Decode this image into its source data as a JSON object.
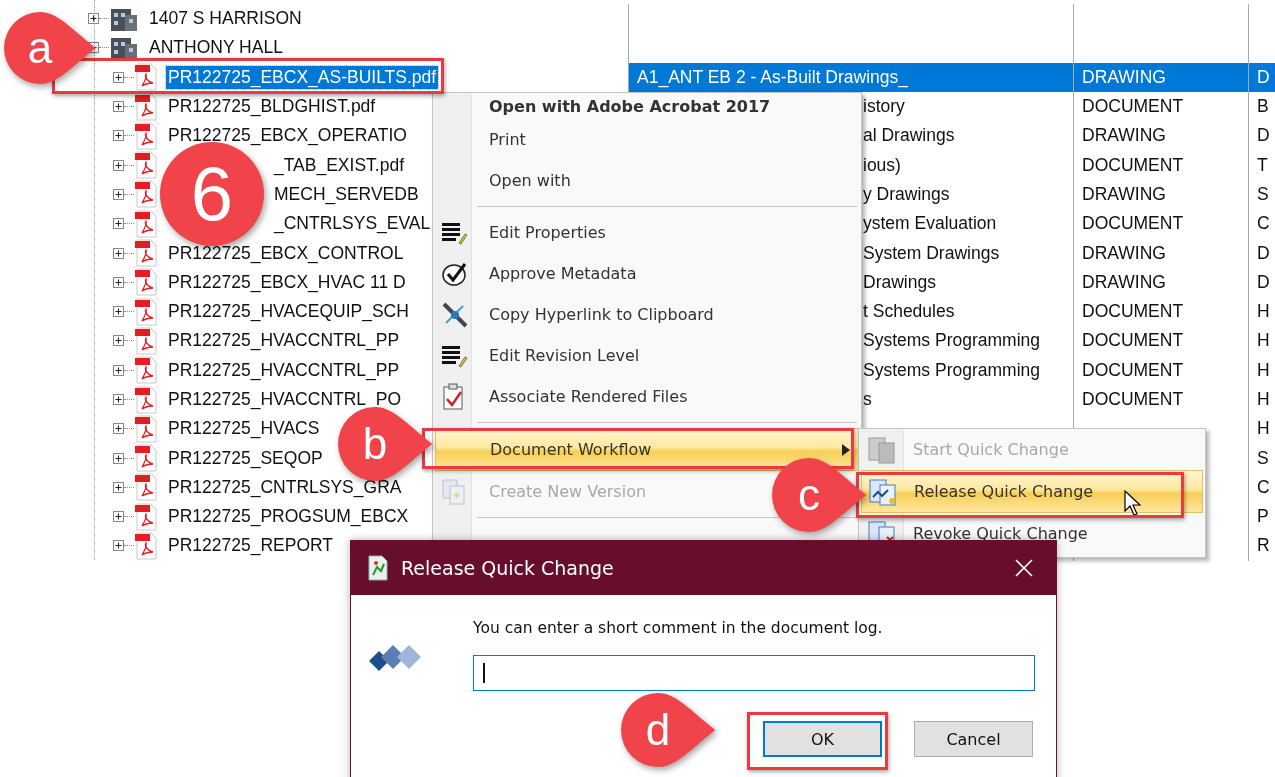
{
  "tree": {
    "rows": [
      {
        "kind": "building",
        "name": "1407 S HARRISON",
        "expanded": false,
        "selected": false,
        "under_callout": false
      },
      {
        "kind": "building",
        "name": "ANTHONY HALL",
        "expanded": true,
        "selected": false,
        "under_callout": false
      },
      {
        "kind": "pdf",
        "name": "PR122725_EBCX_AS-BUILTS.pdf",
        "column_2": "A1_ANT EB 2 - As-Built Drawings_",
        "column_3": "DRAWING",
        "column_4": "D",
        "expanded": false,
        "selected": true,
        "under_callout": false
      },
      {
        "kind": "pdf",
        "name": "PR122725_BLDGHIST.pdf",
        "column_2": "istory",
        "column_3": "DOCUMENT",
        "column_4": "B",
        "expanded": false,
        "selected": false,
        "under_callout": false
      },
      {
        "kind": "pdf",
        "name": "PR122725_EBCX_OPERATIO",
        "column_2": "al Drawings",
        "column_3": "DRAWING",
        "column_4": "D",
        "expanded": false,
        "selected": false,
        "under_callout": false
      },
      {
        "kind": "pdf",
        "name": "_TAB_EXIST.pdf",
        "column_2": "ious)",
        "column_3": "DOCUMENT",
        "column_4": "T",
        "expanded": false,
        "selected": false,
        "under_callout": true
      },
      {
        "kind": "pdf",
        "name": "MECH_SERVEDB",
        "column_2": "y Drawings",
        "column_3": "DRAWING",
        "column_4": "S",
        "expanded": false,
        "selected": false,
        "under_callout": true
      },
      {
        "kind": "pdf",
        "name": "_CNTRLSYS_EVAL",
        "column_2": "ystem Evaluation",
        "column_3": "DOCUMENT",
        "column_4": "C",
        "expanded": false,
        "selected": false,
        "under_callout": true
      },
      {
        "kind": "pdf",
        "name": "PR122725_EBCX_CONTROL",
        "column_2": "System Drawings",
        "column_3": "DRAWING",
        "column_4": "D",
        "expanded": false,
        "selected": false,
        "under_callout": false
      },
      {
        "kind": "pdf",
        "name": "PR122725_EBCX_HVAC 11 D",
        "column_2": "Drawings",
        "column_3": "DRAWING",
        "column_4": "D",
        "expanded": false,
        "selected": false,
        "under_callout": false
      },
      {
        "kind": "pdf",
        "name": "PR122725_HVACEQUIP_SCH",
        "column_2": "t Schedules",
        "column_3": "DOCUMENT",
        "column_4": "H",
        "expanded": false,
        "selected": false,
        "under_callout": false
      },
      {
        "kind": "pdf",
        "name": "PR122725_HVACCNTRL_PP",
        "column_2": "Systems Programming",
        "column_3": "DOCUMENT",
        "column_4": "H",
        "expanded": false,
        "selected": false,
        "under_callout": false
      },
      {
        "kind": "pdf",
        "name": "PR122725_HVACCNTRL_PP",
        "column_2": "Systems Programming",
        "column_3": "DOCUMENT",
        "column_4": "H",
        "expanded": false,
        "selected": false,
        "under_callout": false
      },
      {
        "kind": "pdf",
        "name": "PR122725_HVACCNTRL_PO",
        "column_2": "s",
        "column_3": "DOCUMENT",
        "column_4": "H",
        "expanded": false,
        "selected": false,
        "under_callout": false
      },
      {
        "kind": "pdf",
        "name": "PR122725_HVACS",
        "column_4": "H",
        "expanded": false,
        "selected": false,
        "under_callout": false
      },
      {
        "kind": "pdf",
        "name": "PR122725_SEQOP",
        "column_4": "S",
        "expanded": false,
        "selected": false,
        "under_callout": false
      },
      {
        "kind": "pdf",
        "name": "PR122725_CNTRLSYS_GRA",
        "column_4": "C",
        "expanded": false,
        "selected": false,
        "under_callout": false
      },
      {
        "kind": "pdf",
        "name": "PR122725_PROGSUM_EBCX",
        "column_4": "P",
        "expanded": false,
        "selected": false,
        "under_callout": false
      },
      {
        "kind": "pdf",
        "name": "PR122725_REPORT",
        "column_4": "R",
        "expanded": false,
        "selected": false,
        "under_callout": false
      }
    ]
  },
  "context_menu": {
    "items": [
      {
        "kind": "default",
        "label": "Open with Adobe Acrobat 2017",
        "selected": false,
        "disabled": false
      },
      {
        "kind": "item",
        "label": "Print",
        "selected": false,
        "disabled": false
      },
      {
        "kind": "item",
        "label": "Open with",
        "selected": false,
        "disabled": false
      },
      {
        "kind": "separator"
      },
      {
        "kind": "item",
        "label": "Edit Properties",
        "selected": false,
        "disabled": false
      },
      {
        "kind": "item",
        "label": "Approve Metadata",
        "selected": false,
        "disabled": false
      },
      {
        "kind": "item",
        "label": "Copy Hyperlink to Clipboard",
        "selected": false,
        "disabled": false
      },
      {
        "kind": "item",
        "label": "Edit Revision Level",
        "selected": false,
        "disabled": false
      },
      {
        "kind": "item",
        "label": "Associate Rendered Files",
        "selected": false,
        "disabled": false
      },
      {
        "kind": "separator"
      },
      {
        "kind": "submenu",
        "label": "Document Workflow",
        "selected": true,
        "disabled": false
      },
      {
        "kind": "item",
        "label": "Create New Version",
        "selected": false,
        "disabled": true
      },
      {
        "kind": "separator"
      }
    ]
  },
  "submenu": {
    "items": [
      {
        "label": "Start Quick Change",
        "selected": false,
        "disabled": true
      },
      {
        "label": "Release Quick Change",
        "selected": true,
        "disabled": false
      },
      {
        "label": "Revoke Quick Change",
        "selected": false,
        "disabled": false
      }
    ]
  },
  "dialog": {
    "title": "Release Quick Change",
    "message": "You can enter a short comment in the document log.",
    "comment_field": {
      "focused": true
    },
    "buttons": [
      {
        "label": "OK",
        "focused": true
      },
      {
        "label": "Cancel",
        "focused": false
      }
    ]
  },
  "callouts": [
    {
      "kind": "pointer",
      "label": "a"
    },
    {
      "kind": "circle",
      "label": "6"
    },
    {
      "kind": "pointer",
      "label": "b"
    },
    {
      "kind": "pointer",
      "label": "c"
    },
    {
      "kind": "pointer",
      "label": "d"
    }
  ]
}
